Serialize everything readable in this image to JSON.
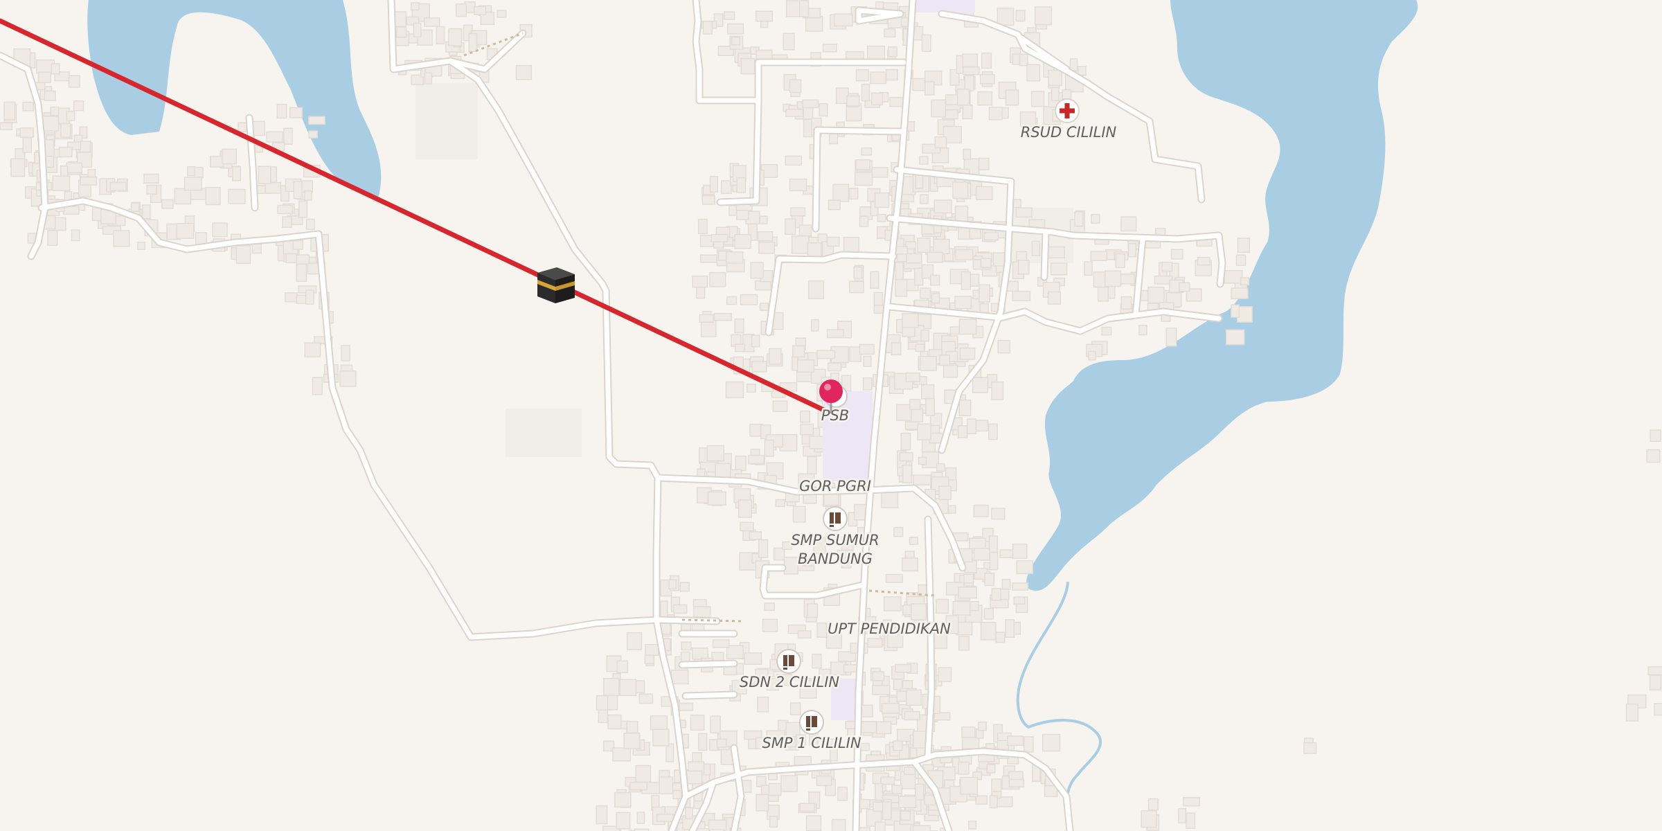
{
  "map": {
    "colors": {
      "land": "#f7f4f0",
      "water": "#a9cde3",
      "road": "#ffffff",
      "road_casing": "#d9d4cd",
      "building": "#efeae4",
      "building_edge": "#e2dcd4",
      "school_area": "#ece6f5",
      "qibla_line": "#d6262e",
      "marker": "#e0245e",
      "hospital_cross": "#c62828"
    },
    "qibla_icon": "kaaba-icon",
    "location_marker": "red-map-pin-icon",
    "pois": [
      {
        "id": "rsud",
        "label": "RSUD CILILIN",
        "icon": "hospital-cross-icon"
      },
      {
        "id": "psb",
        "label": "PSB",
        "icon": "location-pin-icon"
      },
      {
        "id": "gor",
        "label": "GOR PGRI",
        "icon": ""
      },
      {
        "id": "smp-sumur",
        "label_line1": "SMP SUMUR",
        "label_line2": "BANDUNG",
        "icon": "school-icon"
      },
      {
        "id": "upt",
        "label": "UPT PENDIDIKAN",
        "icon": ""
      },
      {
        "id": "sdn2",
        "label": "SDN 2 CILILIN",
        "icon": "school-icon"
      },
      {
        "id": "smp1",
        "label": "SMP 1 CILILIN",
        "icon": "school-icon"
      }
    ]
  }
}
